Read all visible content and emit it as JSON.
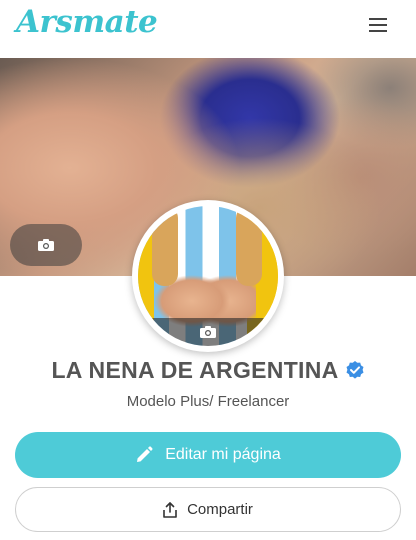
{
  "header": {
    "logo_text": "Arsmate",
    "menu_icon": "hamburger-menu-icon"
  },
  "cover": {
    "camera_icon": "camera-icon"
  },
  "profile": {
    "avatar_camera_icon": "camera-icon",
    "name": "LA NENA DE ARGENTINA",
    "verified_icon": "verified-badge-icon",
    "subtitle": "Modelo Plus/ Freelancer"
  },
  "actions": {
    "edit_label": "Editar mi página",
    "edit_icon": "pencil-icon",
    "share_label": "Compartir",
    "share_icon": "share-icon"
  },
  "colors": {
    "accent": "#4ecbd7",
    "logo": "#3cc3cf",
    "verified": "#3b8fe4"
  }
}
